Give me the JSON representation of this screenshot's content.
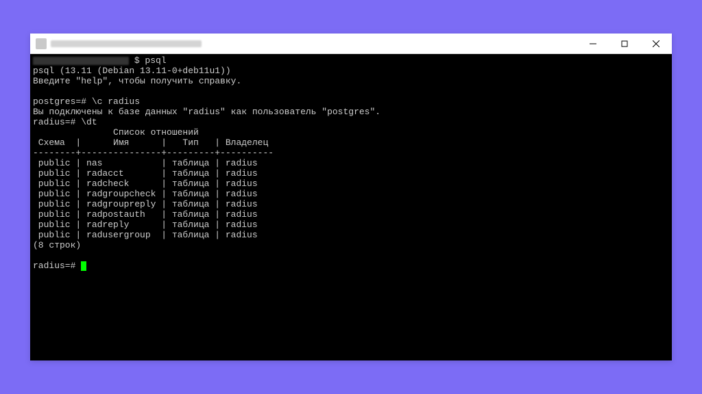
{
  "window": {
    "title_blurred": true
  },
  "terminal": {
    "cmd_psql": "$ psql",
    "version": "psql (13.11 (Debian 13.11-0+deb11u1))",
    "help_hint": "Введите \"help\", чтобы получить справку.",
    "connect_prompt": "postgres=# \\c radius",
    "connected_msg": "Вы подключены к базе данных \"radius\" как пользователь \"postgres\".",
    "dt_prompt": "radius=# \\dt",
    "table_title": "               Список отношений",
    "table_header": " Схема  |      Имя      |   Тип   | Владелец",
    "table_sep": "--------+---------------+---------+----------",
    "rows": [
      " public | nas           | таблица | radius",
      " public | radacct       | таблица | radius",
      " public | radcheck      | таблица | radius",
      " public | radgroupcheck | таблица | radius",
      " public | radgroupreply | таблица | radius",
      " public | radpostauth   | таблица | radius",
      " public | radreply      | таблица | radius",
      " public | radusergroup  | таблица | radius"
    ],
    "row_count": "(8 строк)",
    "final_prompt": "radius=# "
  }
}
